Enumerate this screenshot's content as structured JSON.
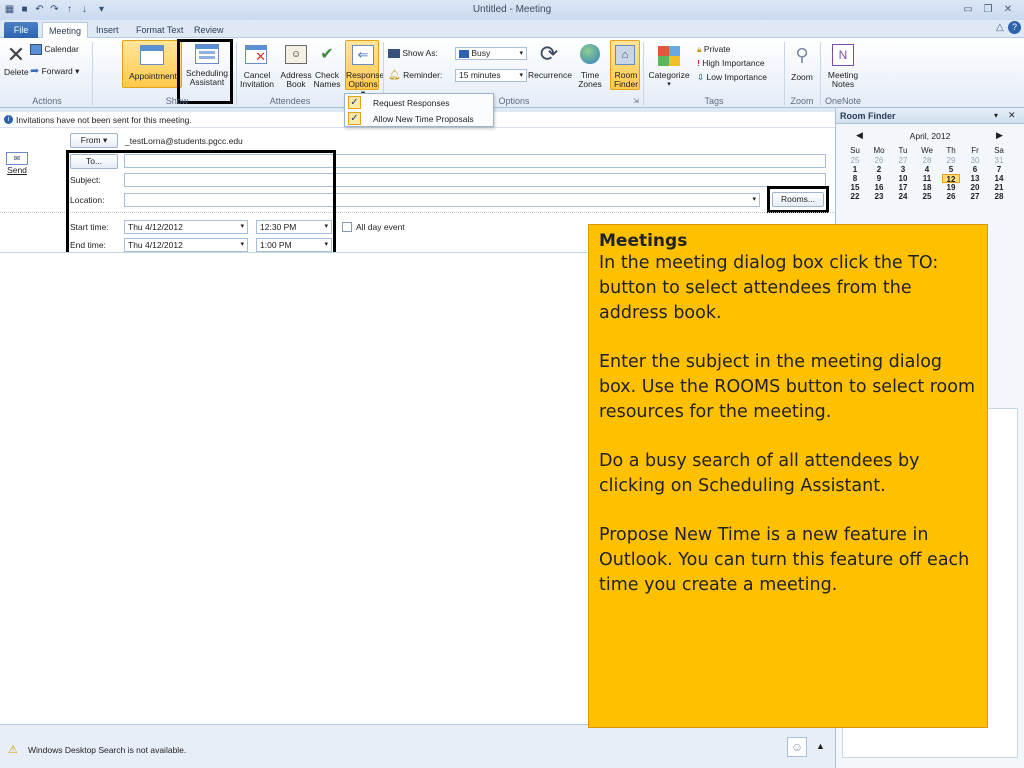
{
  "window": {
    "title": "Untitled  -  Meeting"
  },
  "tabs": [
    {
      "label": "File"
    },
    {
      "label": "Meeting"
    },
    {
      "label": "Insert"
    },
    {
      "label": "Format Text"
    },
    {
      "label": "Review"
    }
  ],
  "ribbon": {
    "actions": {
      "delete": "Delete",
      "calendar": "Calendar",
      "forward": "Forward ▾",
      "group": "Actions"
    },
    "show": {
      "appointment": "Appointment",
      "scheduling_line1": "Scheduling",
      "scheduling_line2": "Assistant",
      "group": "Show"
    },
    "attendees": {
      "cancel_line1": "Cancel",
      "cancel_line2": "Invitation",
      "address_line1": "Address",
      "address_line2": "Book",
      "check_line1": "Check",
      "check_line2": "Names",
      "response_line1": "Response",
      "response_line2": "Options ▾",
      "group": "Attendees"
    },
    "options": {
      "show_as_label": "Show As:",
      "show_as_value": "Busy",
      "reminder_label": "Reminder:",
      "reminder_value": "15 minutes",
      "recurrence": "Recurrence",
      "time_zones_line1": "Time",
      "time_zones_line2": "Zones",
      "room_finder_line1": "Room",
      "room_finder_line2": "Finder",
      "group": "Options"
    },
    "tags": {
      "categorize": "Categorize",
      "private": "Private",
      "high": "High Importance",
      "low": "Low Importance",
      "group": "Tags"
    },
    "zoom": {
      "zoom": "Zoom",
      "group": "Zoom"
    },
    "onenote": {
      "notes_line1": "Meeting",
      "notes_line2": "Notes",
      "group": "OneNote"
    }
  },
  "dropdown": {
    "items": [
      {
        "label": "Request Responses",
        "checked": true
      },
      {
        "label": "Allow New Time Proposals",
        "checked": true
      }
    ]
  },
  "form": {
    "info": "Invitations have not been sent for this meeting.",
    "from_button": "From ▾",
    "from_value": "_testLorna@students.pgcc.edu",
    "send": "Send",
    "to_button": "To...",
    "subject_label": "Subject:",
    "location_label": "Location:",
    "rooms_button": "Rooms...",
    "start_label": "Start time:",
    "start_date": "Thu 4/12/2012",
    "start_time": "12:30 PM",
    "all_day": "All day event",
    "end_label": "End time:",
    "end_date": "Thu 4/12/2012",
    "end_time": "1:00 PM"
  },
  "status": {
    "text": "Windows Desktop Search is not available."
  },
  "room_finder": {
    "title": "Room Finder",
    "month": "April, 2012",
    "weekdays": [
      "Su",
      "Mo",
      "Tu",
      "We",
      "Th",
      "Fr",
      "Sa"
    ],
    "weeks": [
      [
        "25",
        "26",
        "27",
        "28",
        "29",
        "30",
        "31"
      ],
      [
        "1",
        "2",
        "3",
        "4",
        "5",
        "6",
        "7"
      ],
      [
        "8",
        "9",
        "10",
        "11",
        "12",
        "13",
        "14"
      ],
      [
        "15",
        "16",
        "17",
        "18",
        "19",
        "20",
        "21"
      ],
      [
        "22",
        "23",
        "24",
        "25",
        "26",
        "27",
        "28"
      ]
    ],
    "today": "12"
  },
  "callout": {
    "title": "Meetings",
    "paragraphs": [
      "In the meeting dialog box click the TO: button to select attendees from the address book.",
      "Enter the subject in the meeting dialog box. Use the ROOMS button to select room resources for the meeting.",
      "Do a busy search of all attendees by clicking on Scheduling Assistant.",
      "Propose New Time is a new feature in Outlook. You can turn this feature off each time you create a meeting."
    ]
  },
  "colors": {
    "callout": "#ffc000",
    "file_tab": "#2e62ad",
    "highlight": "#000000"
  }
}
